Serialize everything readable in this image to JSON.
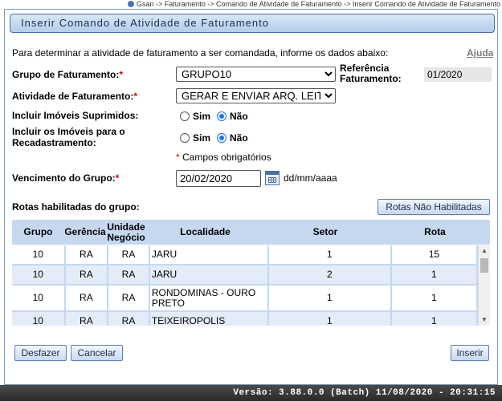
{
  "breadcrumb": "Gsan -> Faturamento -> Comando de Atividade de Faturamento -> Inserir Comando de Atividade de Faturamento",
  "title": "Inserir Comando de Atividade de Faturamento",
  "intro": "Para determinar a atividade de faturamento a ser comandada, informe os dados abaixo:",
  "help_link": "Ajuda",
  "form": {
    "grupo_label": "Grupo de Faturamento:",
    "grupo_value": "GRUPO10",
    "referencia_label_1": "Referência",
    "referencia_label_2": "Faturamento:",
    "referencia_value": "01/2020",
    "atividade_label": "Atividade de Faturamento:",
    "atividade_value": "GERAR E ENVIAR ARQ. LEITURA",
    "suprimidos_label": "Incluir Imóveis Suprimidos:",
    "recad_label_1": "Incluir os Imóveis para o",
    "recad_label_2": "Recadastramento:",
    "sim": "Sim",
    "nao": "Não",
    "required_note": "Campos obrigatórios",
    "required_mark": "*",
    "vencimento_label": "Vencimento do Grupo:",
    "vencimento_value": "20/02/2020",
    "date_format": "dd/mm/aaaa"
  },
  "rotas": {
    "label": "Rotas habilitadas do grupo:",
    "nao_habilitadas_button": "Rotas Não Habilitadas",
    "headers": {
      "grupo": "Grupo",
      "gerencia": "Gerência",
      "unidade_1": "Unidade",
      "unidade_2": "Negócio",
      "localidade": "Localidade",
      "setor": "Setor",
      "rota": "Rota"
    },
    "rows": [
      {
        "grupo": "10",
        "gerencia": "RA",
        "unidade": "RA",
        "localidade": "JARU",
        "setor": "1",
        "rota": "15"
      },
      {
        "grupo": "10",
        "gerencia": "RA",
        "unidade": "RA",
        "localidade": "JARU",
        "setor": "2",
        "rota": "1"
      },
      {
        "grupo": "10",
        "gerencia": "RA",
        "unidade": "RA",
        "localidade": "RONDOMINAS - OURO PRETO",
        "setor": "1",
        "rota": "1"
      },
      {
        "grupo": "10",
        "gerencia": "RA",
        "unidade": "RA",
        "localidade": "TEIXEIROPOLIS",
        "setor": "1",
        "rota": "1"
      }
    ]
  },
  "buttons": {
    "desfazer": "Desfazer",
    "cancelar": "Cancelar",
    "inserir": "Inserir"
  },
  "footer": "Versão: 3.88.0.0 (Batch) 11/08/2020 - 20:31:15",
  "icons": {
    "calendar": "calendar-icon",
    "breadcrumb_dot": "home-dot-icon"
  },
  "colors": {
    "title_bar": "#c5d8f0",
    "grid_header": "#c5d8f0",
    "required": "#dd0000"
  }
}
